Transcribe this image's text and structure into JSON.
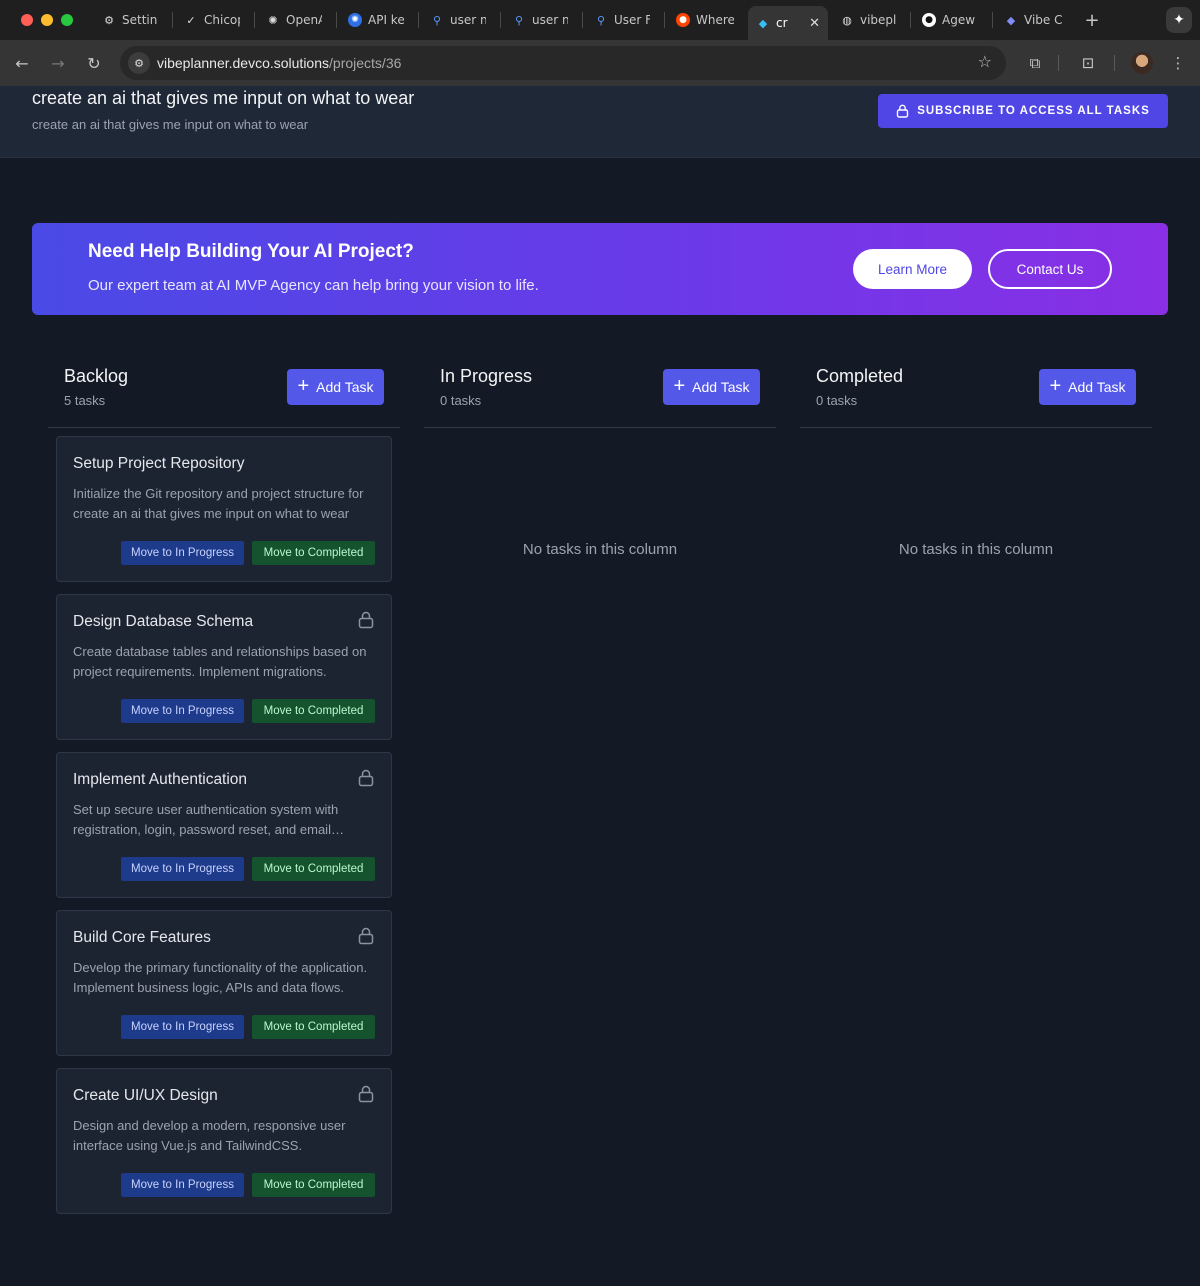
{
  "browser": {
    "tabs": [
      {
        "title": "Settings",
        "icon": "gear-icon"
      },
      {
        "title": "Chicop",
        "icon": "check-icon"
      },
      {
        "title": "OpenAI",
        "icon": "openai-icon"
      },
      {
        "title": "API keys",
        "icon": "openai-blue-icon"
      },
      {
        "title": "user n",
        "icon": "search-icon"
      },
      {
        "title": "user n",
        "icon": "search-icon"
      },
      {
        "title": "User F",
        "icon": "search-icon"
      },
      {
        "title": "Where",
        "icon": "reddit-icon"
      },
      {
        "title": "cr",
        "icon": "cube-icon",
        "active": true
      },
      {
        "title": "vibepl",
        "icon": "globe-icon"
      },
      {
        "title": "Agew",
        "icon": "github-icon"
      },
      {
        "title": "Vibe C",
        "icon": "cube-icon"
      }
    ],
    "url_host": "vibeplanner.devco.solutions",
    "url_path": "/projects/36"
  },
  "project": {
    "title": "create an ai that gives me input on what to wear",
    "subtitle": "create an ai that gives me input on what to wear",
    "subscribe_label": "SUBSCRIBE TO ACCESS ALL TASKS"
  },
  "banner": {
    "title": "Need Help Building Your AI Project?",
    "text": "Our expert team at AI MVP Agency can help bring your vision to life.",
    "learn_more": "Learn More",
    "contact_us": "Contact Us"
  },
  "columns": [
    {
      "title": "Backlog",
      "count": "5 tasks",
      "add_label": "Add Task",
      "empty_text": ""
    },
    {
      "title": "In Progress",
      "count": "0 tasks",
      "add_label": "Add Task",
      "empty_text": "No tasks in this column"
    },
    {
      "title": "Completed",
      "count": "0 tasks",
      "add_label": "Add Task",
      "empty_text": "No tasks in this column"
    }
  ],
  "tasks": [
    {
      "title": "Setup Project Repository",
      "description": "Initialize the Git repository and project structure for create an ai that gives me input on what to wear",
      "locked": false
    },
    {
      "title": "Design Database Schema",
      "description": "Create database tables and relationships based on project requirements. Implement migrations.",
      "locked": true
    },
    {
      "title": "Implement Authentication",
      "description": "Set up secure user authentication system with registration, login, password reset, and email verification.",
      "locked": true
    },
    {
      "title": "Build Core Features",
      "description": "Develop the primary functionality of the application. Implement business logic, APIs and data flows.",
      "locked": true
    },
    {
      "title": "Create UI/UX Design",
      "description": "Design and develop a modern, responsive user interface using Vue.js and TailwindCSS.",
      "locked": true
    }
  ],
  "task_actions": {
    "move_progress": "Move to In Progress",
    "move_completed": "Move to Completed"
  }
}
